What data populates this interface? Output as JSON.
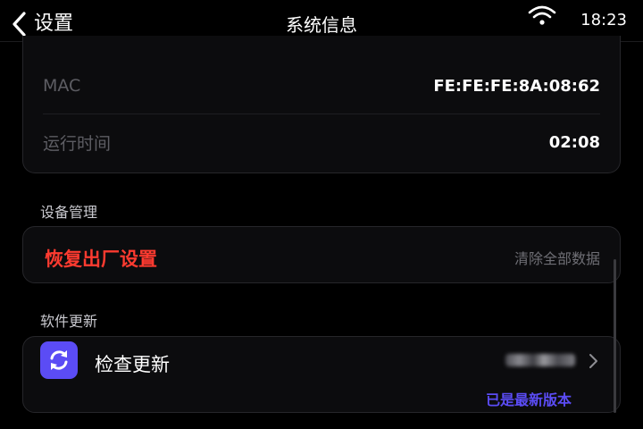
{
  "header": {
    "back_label": "设置",
    "title": "系统信息",
    "time": "18:23",
    "wifi_icon": "wifi-icon"
  },
  "info": {
    "mac_label": "MAC",
    "mac_value": "FE:FE:FE:8A:08:62",
    "uptime_label": "运行时间",
    "uptime_value": "02:08"
  },
  "device_management": {
    "section_label": "设备管理",
    "reset_title": "恢复出厂设置",
    "reset_subtitle": "清除全部数据"
  },
  "software_update": {
    "section_label": "软件更新",
    "title": "检查更新",
    "status": "已是最新版本",
    "icon": "refresh-icon"
  },
  "colors": {
    "background": "#000000",
    "card": "#0c0c0e",
    "danger": "#ff3b30",
    "accent": "#5b4cf5"
  }
}
